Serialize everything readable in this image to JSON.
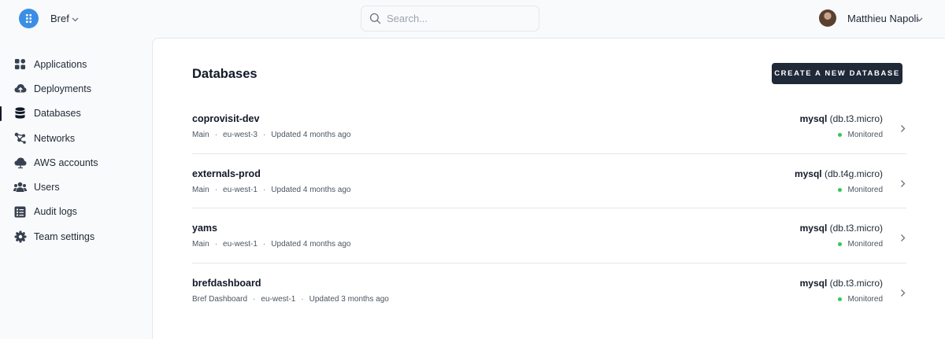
{
  "header": {
    "team_name": "Bref",
    "search_placeholder": "Search...",
    "user_name": "Matthieu Napoli"
  },
  "sidebar": {
    "items": [
      {
        "label": "Applications",
        "icon": "applications-icon"
      },
      {
        "label": "Deployments",
        "icon": "cloud-upload-icon"
      },
      {
        "label": "Databases",
        "icon": "database-icon",
        "active": true
      },
      {
        "label": "Networks",
        "icon": "network-icon"
      },
      {
        "label": "AWS accounts",
        "icon": "cloud-icon"
      },
      {
        "label": "Users",
        "icon": "users-icon"
      },
      {
        "label": "Audit logs",
        "icon": "audit-log-icon"
      },
      {
        "label": "Team settings",
        "icon": "gear-icon"
      }
    ]
  },
  "main": {
    "title": "Databases",
    "create_label": "CREATE A NEW DATABASE",
    "databases": [
      {
        "name": "coprovisit-dev",
        "environment": "Main",
        "region": "eu-west-3",
        "updated": "Updated 4 months ago",
        "engine": "mysql",
        "instance": "(db.t3.micro)",
        "status": "Monitored"
      },
      {
        "name": "externals-prod",
        "environment": "Main",
        "region": "eu-west-1",
        "updated": "Updated 4 months ago",
        "engine": "mysql",
        "instance": "(db.t4g.micro)",
        "status": "Monitored"
      },
      {
        "name": "yams",
        "environment": "Main",
        "region": "eu-west-1",
        "updated": "Updated 4 months ago",
        "engine": "mysql",
        "instance": "(db.t3.micro)",
        "status": "Monitored"
      },
      {
        "name": "brefdashboard",
        "environment": "Bref Dashboard",
        "region": "eu-west-1",
        "updated": "Updated 3 months ago",
        "engine": "mysql",
        "instance": "(db.t3.micro)",
        "status": "Monitored"
      }
    ]
  },
  "colors": {
    "accent": "#3b8ee6",
    "button_bg": "#1f2937",
    "status_ok": "#34c759"
  }
}
